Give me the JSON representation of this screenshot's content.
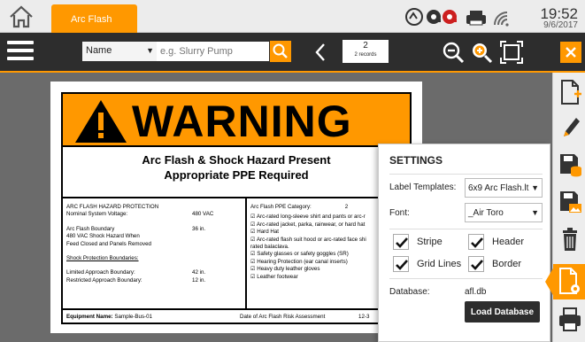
{
  "tabs": [
    {
      "label": "Arc Flash",
      "active": true
    }
  ],
  "clock": {
    "time": "19:52",
    "date": "9/6/2017"
  },
  "toolbar": {
    "search_field": "Name",
    "search_placeholder": "e.g. Slurry Pump",
    "record_number": "2",
    "record_count_label": "2 records"
  },
  "label": {
    "warning": "WARNING",
    "headline_1": "Arc Flash & Shock Hazard Present",
    "headline_2": "Appropriate PPE Required",
    "left": {
      "section_title": "ARC FLASH HAZARD PROTECTION",
      "voltage_label": "Nominal System Voltage:",
      "voltage_value": "480 VAC",
      "boundary_label": "Arc Flash Boundary",
      "boundary_value": "36 in.",
      "shock_hazard_1": "480 VAC Shock Hazard When",
      "shock_hazard_2": "Feed Closed and Panels Removed",
      "shock_title": "Shock Protection Boundaries:",
      "limited_label": "Limited Approach Boundary:",
      "limited_value": "42 in.",
      "restricted_label": "Restricted Approach Boundary:",
      "restricted_value": "12 in."
    },
    "right": {
      "ppe_label": "Arc Flash PPE Category:",
      "ppe_value": "2",
      "items": [
        "☑ Arc-rated long-sleeve shirt and pants or arc-r",
        "☑ Arc-rated jacket, parka, rainwear, or hard hat",
        "☑ Hard Hat",
        "☑ Arc-rated flash suit hood or arc-rated face shi",
        "rated balaclava.",
        "☑ Safety glasses or safety goggles (SR)",
        "☑ Hearing Protection (ear canal inserts)",
        "☑ Heavy duty leather gloves",
        "☑ Leather footwear"
      ]
    },
    "footer": {
      "equipment_label": "Equipment Name:",
      "equipment_value": "Sample-Bus-01",
      "date_label": "Date of Arc Flash Risk Assessment",
      "date_value": "12-3"
    }
  },
  "settings": {
    "title": "SETTINGS",
    "template_label": "Label Templates:",
    "template_value": "6x9 Arc Flash.lt",
    "font_label": "Font:",
    "font_value": "_Air Toro",
    "checkboxes": [
      {
        "label": "Stripe",
        "checked": true
      },
      {
        "label": "Header",
        "checked": true
      },
      {
        "label": "Grid Lines",
        "checked": true
      },
      {
        "label": "Border",
        "checked": true
      }
    ],
    "database_label": "Database:",
    "database_value": "afl.db",
    "load_button": "Load Database"
  },
  "colors": {
    "accent": "#ff9800",
    "toolbar": "#2d2d2d"
  }
}
